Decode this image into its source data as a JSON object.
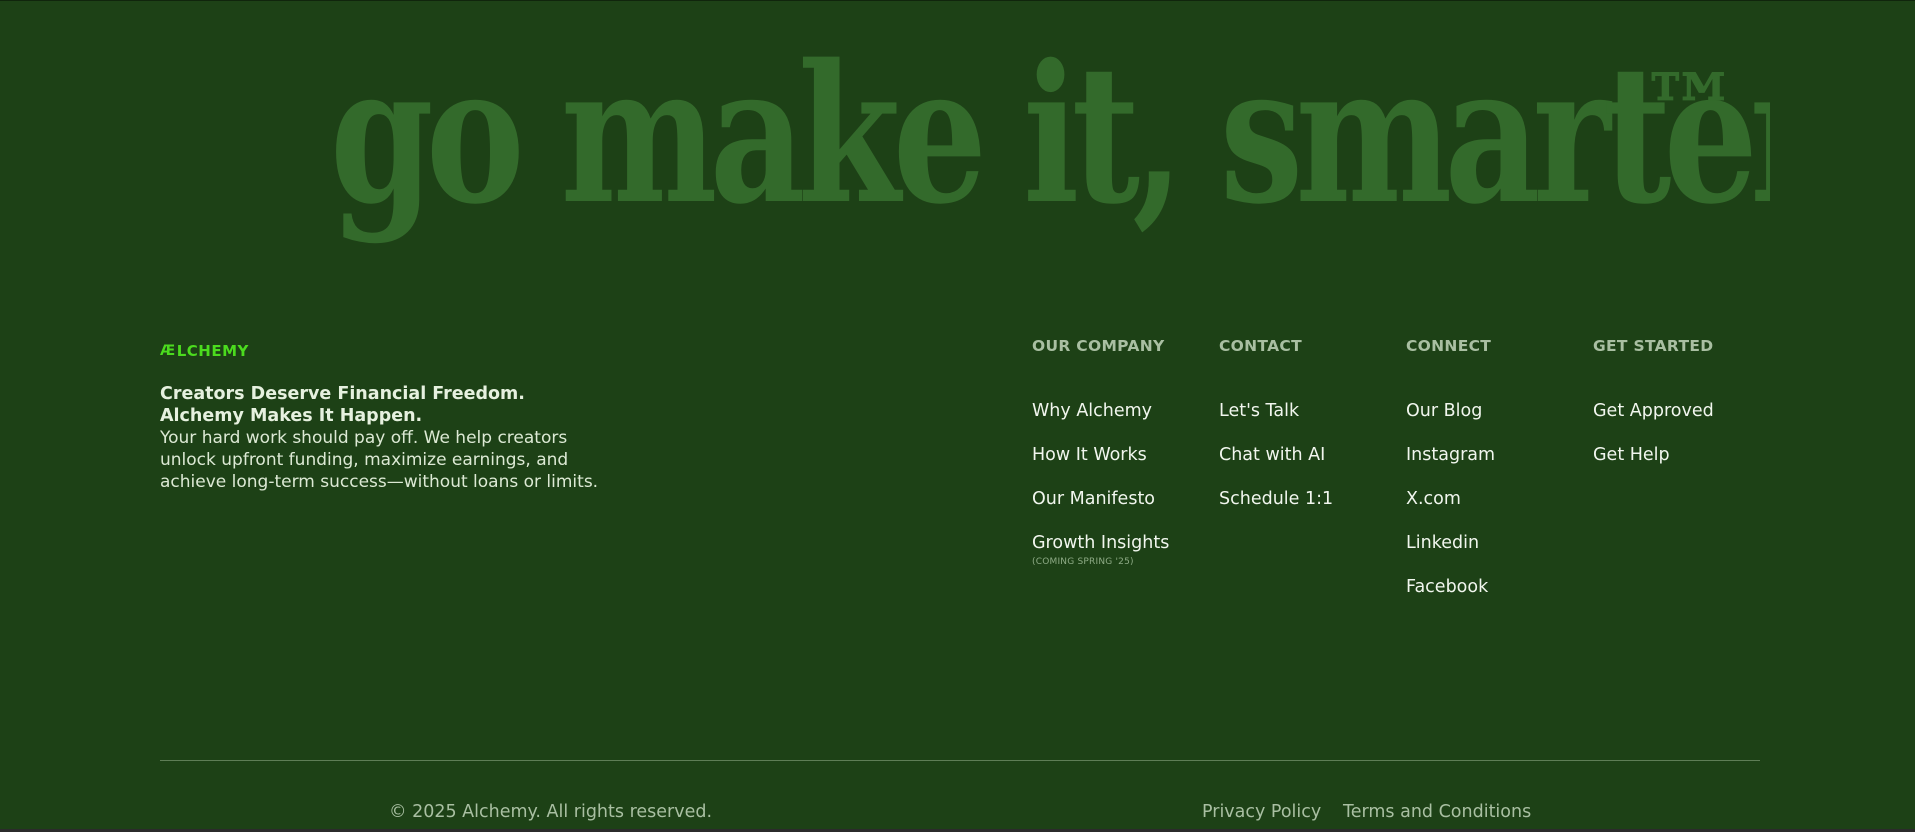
{
  "hero": {
    "tagline": "go make it, smarter",
    "trademark": "™"
  },
  "brand": {
    "mark": "Æ",
    "name": "LCHEMY",
    "color": "#4bdb1e"
  },
  "intro": {
    "headline": "Creators Deserve Financial Freedom. Alchemy Makes It Happen.",
    "body": "Your hard work should pay off. We help creators unlock upfront funding, maximize earnings, and achieve long-term success—without loans or limits."
  },
  "columns": [
    {
      "heading": "OUR COMPANY",
      "links": [
        {
          "label": "Why Alchemy"
        },
        {
          "label": "How It Works"
        },
        {
          "label": "Our Manifesto"
        },
        {
          "label": "Growth Insights",
          "note": "(COMING SPRING '25)"
        }
      ]
    },
    {
      "heading": "CONTACT",
      "links": [
        {
          "label": "Let's Talk"
        },
        {
          "label": "Chat with AI"
        },
        {
          "label": "Schedule 1:1"
        }
      ]
    },
    {
      "heading": "CONNECT",
      "links": [
        {
          "label": "Our Blog"
        },
        {
          "label": "Instagram"
        },
        {
          "label": "X.com"
        },
        {
          "label": "Linkedin"
        },
        {
          "label": "Facebook"
        }
      ]
    },
    {
      "heading": "GET STARTED",
      "links": [
        {
          "label": "Get Approved"
        },
        {
          "label": "Get Help"
        }
      ]
    }
  ],
  "footer": {
    "copyright": "© 2025 Alchemy. All rights reserved.",
    "privacy": "Privacy Policy",
    "terms": "Terms and Conditions"
  },
  "colors": {
    "background": "#1d4116",
    "hero_text": "#336a2b",
    "muted": "#a9bfa2"
  }
}
